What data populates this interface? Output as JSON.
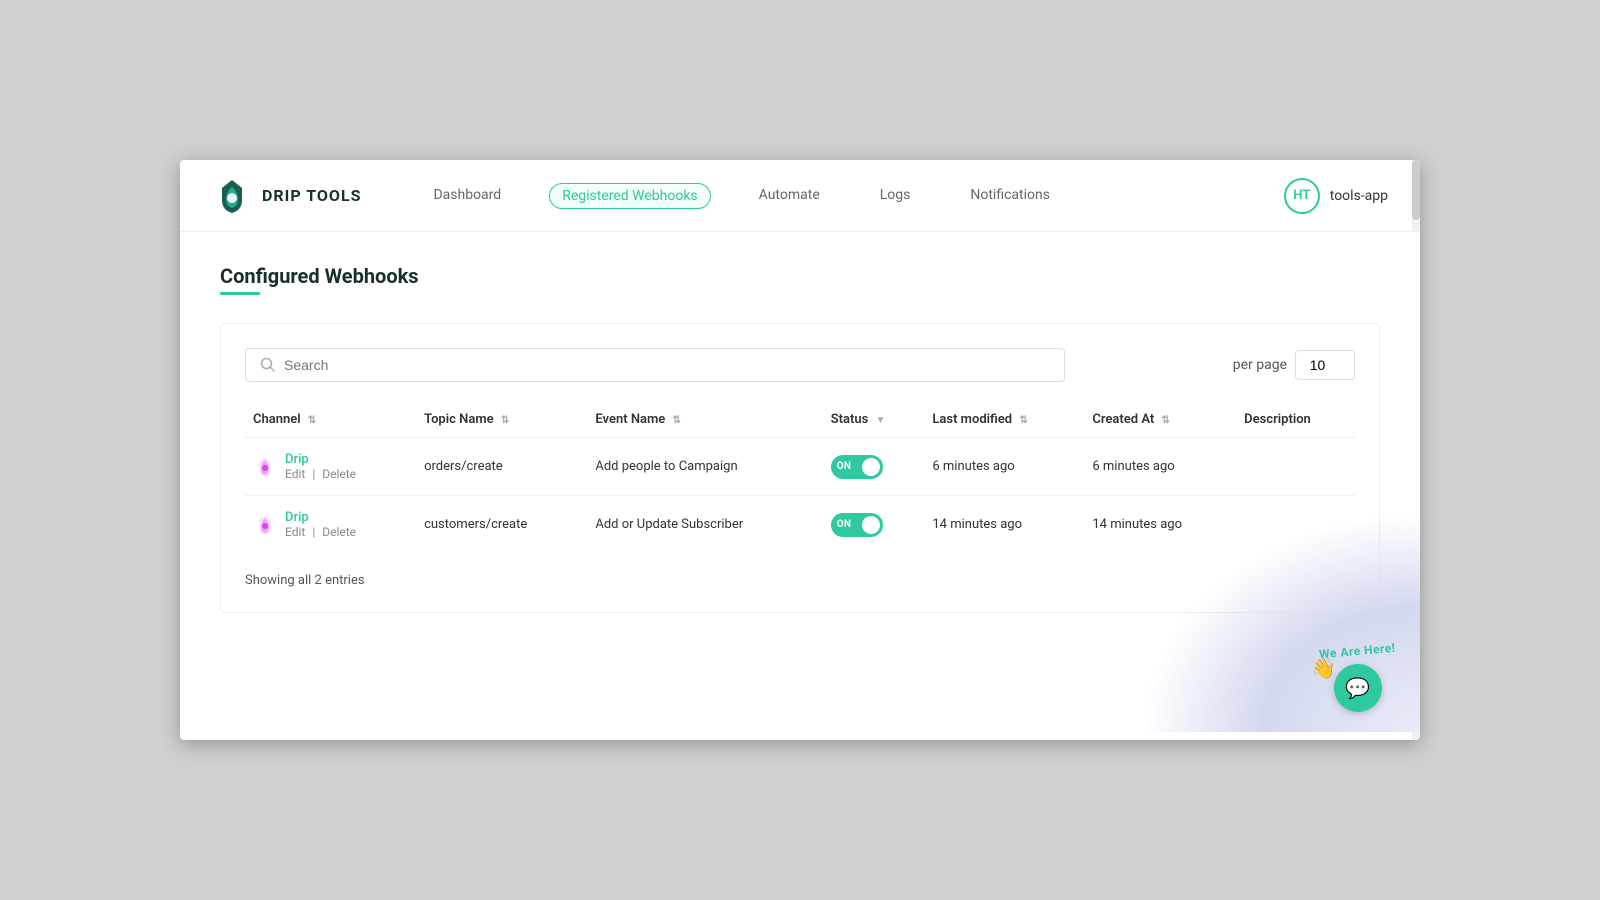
{
  "app": {
    "title": "DRIP TOOLS",
    "user": {
      "initials": "HT",
      "name": "tools-app"
    }
  },
  "nav": {
    "links": [
      {
        "label": "Dashboard",
        "active": false,
        "key": "dashboard"
      },
      {
        "label": "Registered Webhooks",
        "active": true,
        "key": "registered-webhooks"
      },
      {
        "label": "Automate",
        "active": false,
        "key": "automate"
      },
      {
        "label": "Logs",
        "active": false,
        "key": "logs"
      },
      {
        "label": "Notifications",
        "active": false,
        "key": "notifications"
      }
    ]
  },
  "page": {
    "title": "Configured Webhooks"
  },
  "toolbar": {
    "search_placeholder": "Search",
    "per_page_label": "per page",
    "per_page_value": "10"
  },
  "table": {
    "columns": [
      {
        "label": "Channel",
        "sortable": true
      },
      {
        "label": "Topic Name",
        "sortable": true
      },
      {
        "label": "Event Name",
        "sortable": true
      },
      {
        "label": "Status",
        "sortable": true,
        "sort_active": true
      },
      {
        "label": "Last modified",
        "sortable": true
      },
      {
        "label": "Created At",
        "sortable": true
      },
      {
        "label": "Description",
        "sortable": false
      }
    ],
    "rows": [
      {
        "channel_name": "Drip",
        "edit_label": "Edit",
        "delete_label": "Delete",
        "topic": "orders/create",
        "event": "Add people to Campaign",
        "status": "ON",
        "last_modified": "6 minutes ago",
        "created_at": "6 minutes ago",
        "description": ""
      },
      {
        "channel_name": "Drip",
        "edit_label": "Edit",
        "delete_label": "Delete",
        "topic": "customers/create",
        "event": "Add or Update Subscriber",
        "status": "ON",
        "last_modified": "14 minutes ago",
        "created_at": "14 minutes ago",
        "description": ""
      }
    ],
    "footer": "Showing all 2 entries"
  },
  "chat": {
    "we_are_here": "We Are Here!"
  }
}
